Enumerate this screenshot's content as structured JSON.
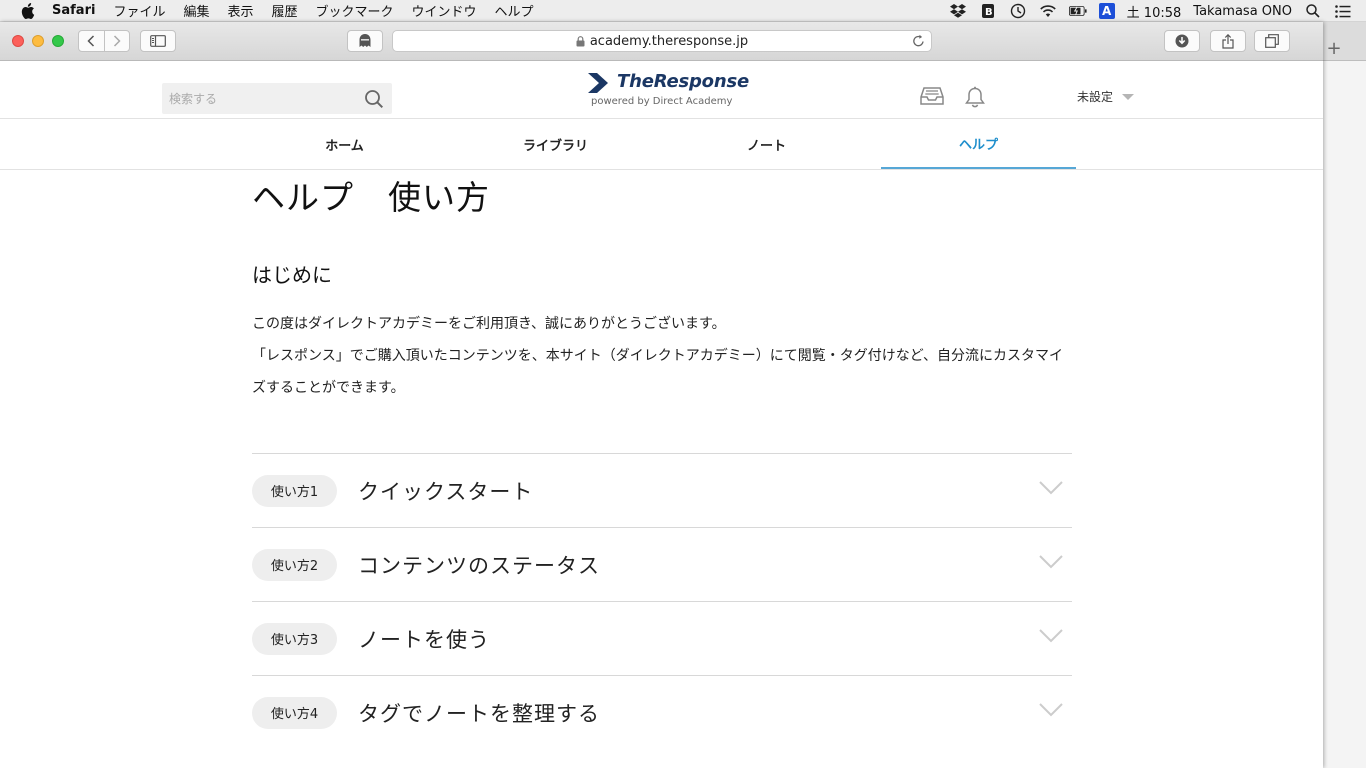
{
  "menubar": {
    "app_name": "Safari",
    "items": [
      "ファイル",
      "編集",
      "表示",
      "履歴",
      "ブックマーク",
      "ウインドウ",
      "ヘルプ"
    ],
    "clock": "土 10:58",
    "user": "Takamasa ONO",
    "input_indicator": "A"
  },
  "browser": {
    "url": "academy.theresponse.jp"
  },
  "site": {
    "search_placeholder": "検索する",
    "logo_name": "TheResponse",
    "logo_tagline": "powered by Direct Academy",
    "user_menu_label": "未設定",
    "brand_color": "#1b3764",
    "accent_color": "#1e8ecc"
  },
  "nav": {
    "items": [
      "ホーム",
      "ライブラリ",
      "ノート",
      "ヘルプ"
    ],
    "active": "ヘルプ"
  },
  "main": {
    "title": "ヘルプ　使い方",
    "section_title": "はじめに",
    "intro_line1": "この度はダイレクトアカデミーをご利用頂き、誠にありがとうございます。",
    "intro_line2": "「レスポンス」でご購入頂いたコンテンツを、本サイト（ダイレクトアカデミー）にて閲覧・タグ付けなど、自分流にカスタマイズすることができます。"
  },
  "faq": [
    {
      "badge": "使い方1",
      "title": "クイックスタート"
    },
    {
      "badge": "使い方2",
      "title": "コンテンツのステータス"
    },
    {
      "badge": "使い方3",
      "title": "ノートを使う"
    },
    {
      "badge": "使い方4",
      "title": "タグでノートを整理する"
    }
  ],
  "icons": [
    "apple-icon",
    "dropbox-icon",
    "time-machine-icon",
    "wifi-icon",
    "battery-icon",
    "spotlight-icon",
    "notification-center-icon",
    "search-icon",
    "inbox-icon",
    "bell-icon",
    "chevron-down-icon",
    "lock-icon",
    "reload-icon",
    "download-icon",
    "share-icon",
    "tabs-icon"
  ]
}
